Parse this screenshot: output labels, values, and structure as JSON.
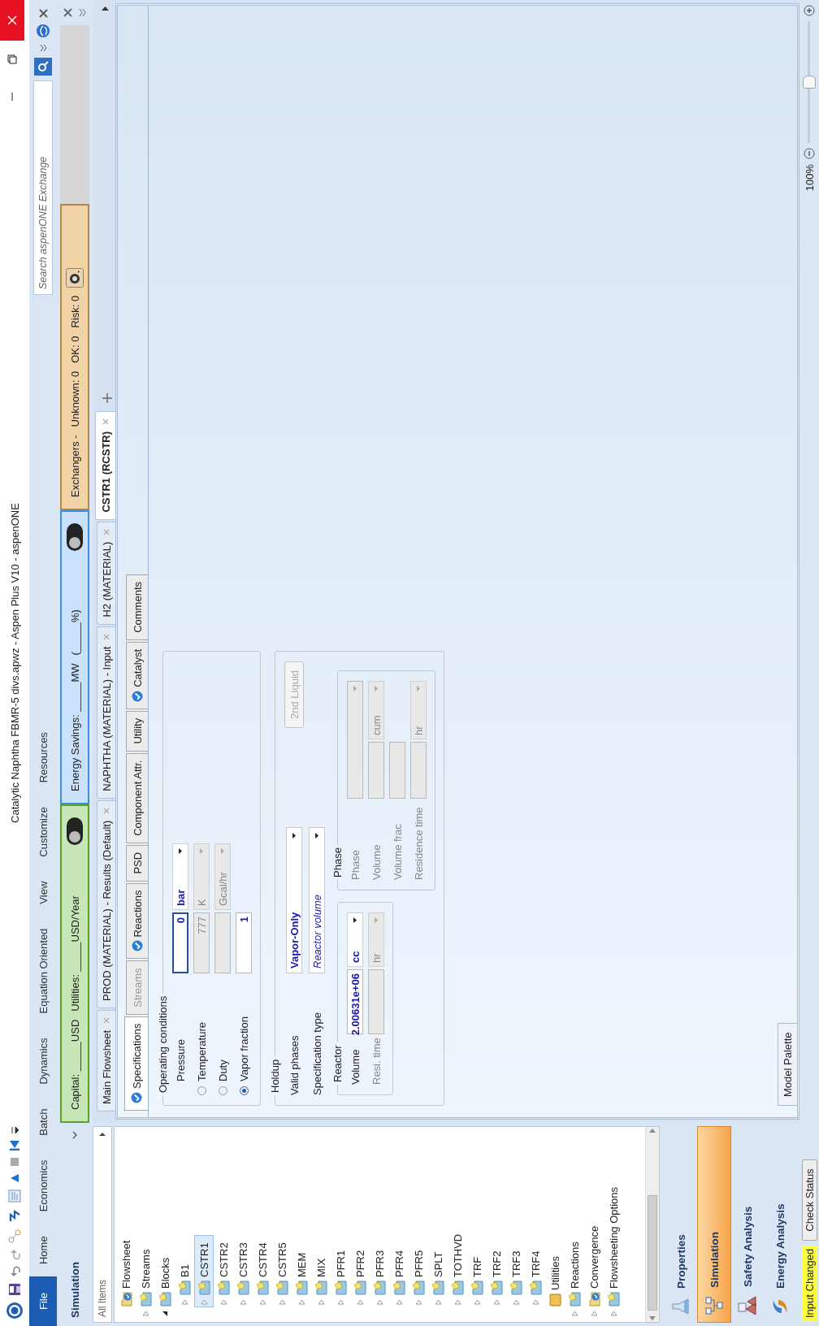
{
  "window": {
    "title": "Catalytic Naphtha FBMR-5 divs.apwz - Aspen Plus V10 - aspenONE"
  },
  "ribbon": {
    "tabs": [
      {
        "label": "File",
        "kind": "file",
        "selected": false
      },
      {
        "label": "Home",
        "kind": "tab",
        "selected": false
      },
      {
        "label": "Economics",
        "kind": "tab",
        "selected": false
      },
      {
        "label": "Batch",
        "kind": "tab",
        "selected": false
      },
      {
        "label": "Dynamics",
        "kind": "tab",
        "selected": false
      },
      {
        "label": "Equation Oriented",
        "kind": "tab",
        "selected": false
      },
      {
        "label": "View",
        "kind": "tab",
        "selected": false
      },
      {
        "label": "Customize",
        "kind": "tab",
        "selected": false
      },
      {
        "label": "Resources",
        "kind": "tab",
        "selected": false
      }
    ],
    "search": {
      "placeholder": "Search aspenONE Exchange"
    }
  },
  "economics": {
    "capital": "Capital: _____USD",
    "utilities": "Utilities: _____USD/Year",
    "toggle_on": false
  },
  "energy": {
    "savings": "Energy Savings: _____MW",
    "percent": "(_____%)",
    "toggle_on": false
  },
  "exchangers": {
    "label": "Exchangers -",
    "unknown": "Unknown: 0",
    "ok": "OK: 0",
    "risk": "Risk: 0"
  },
  "navigator": {
    "title": "Simulation",
    "filter": "All Items",
    "tree": [
      {
        "label": "Flowsheet",
        "kind": "check-folder",
        "selected": false
      },
      {
        "label": "Streams",
        "kind": "folder",
        "expanded": false,
        "selected": false
      },
      {
        "label": "Blocks",
        "kind": "folder",
        "expanded": true,
        "selected": false,
        "children": [
          {
            "label": "B1",
            "kind": "folder",
            "expanded": false,
            "selected": false
          },
          {
            "label": "CSTR1",
            "kind": "folder",
            "expanded": false,
            "selected": true
          },
          {
            "label": "CSTR2",
            "kind": "folder",
            "expanded": false,
            "selected": false
          },
          {
            "label": "CSTR3",
            "kind": "folder",
            "expanded": false,
            "selected": false
          },
          {
            "label": "CSTR4",
            "kind": "folder",
            "expanded": false,
            "selected": false
          },
          {
            "label": "CSTR5",
            "kind": "folder",
            "expanded": false,
            "selected": false
          },
          {
            "label": "MEM",
            "kind": "folder",
            "expanded": false,
            "selected": false
          },
          {
            "label": "MIX",
            "kind": "folder",
            "expanded": false,
            "selected": false
          },
          {
            "label": "PFR1",
            "kind": "folder",
            "expanded": false,
            "selected": false
          },
          {
            "label": "PFR2",
            "kind": "folder",
            "expanded": false,
            "selected": false
          },
          {
            "label": "PFR3",
            "kind": "folder",
            "expanded": false,
            "selected": false
          },
          {
            "label": "PFR4",
            "kind": "folder",
            "expanded": false,
            "selected": false
          },
          {
            "label": "PFR5",
            "kind": "folder",
            "expanded": false,
            "selected": false
          },
          {
            "label": "SPLT",
            "kind": "folder",
            "expanded": false,
            "selected": false
          },
          {
            "label": "TOTHVD",
            "kind": "folder",
            "expanded": false,
            "selected": false
          },
          {
            "label": "TRF",
            "kind": "folder",
            "expanded": false,
            "selected": false
          },
          {
            "label": "TRF2",
            "kind": "folder",
            "expanded": false,
            "selected": false
          },
          {
            "label": "TRF3",
            "kind": "folder",
            "expanded": false,
            "selected": false
          },
          {
            "label": "TRF4",
            "kind": "folder",
            "expanded": false,
            "selected": false
          }
        ]
      },
      {
        "label": "Utilities",
        "kind": "plain-folder",
        "selected": false
      },
      {
        "label": "Reactions",
        "kind": "folder",
        "expanded": false,
        "selected": false
      },
      {
        "label": "Convergence",
        "kind": "check-folder",
        "expanded": false,
        "selected": false
      },
      {
        "label": "Flowsheeting Options",
        "kind": "folder",
        "expanded": false,
        "selected": false
      }
    ],
    "buttons": [
      {
        "label": "Properties",
        "kind": "properties",
        "selected": false
      },
      {
        "label": "Simulation",
        "kind": "simulation",
        "selected": true
      },
      {
        "label": "Safety Analysis",
        "kind": "safety",
        "selected": false
      },
      {
        "label": "Energy Analysis",
        "kind": "energy",
        "selected": false
      }
    ]
  },
  "document_tabs": [
    {
      "label": "Main Flowsheet",
      "selected": false
    },
    {
      "label": "PROD (MATERIAL) - Results (Default)",
      "selected": false
    },
    {
      "label": "NAPHTHA (MATERIAL) - Input",
      "selected": false
    },
    {
      "label": "H2 (MATERIAL)",
      "selected": false
    },
    {
      "label": "CSTR1 (RCSTR)",
      "selected": true
    }
  ],
  "form_tabs": [
    {
      "label": "Specifications",
      "complete": true,
      "disabled": false,
      "selected": true
    },
    {
      "label": "Streams",
      "complete": false,
      "disabled": true,
      "selected": false
    },
    {
      "label": "Reactions",
      "complete": true,
      "disabled": false,
      "selected": false
    },
    {
      "label": "PSD",
      "complete": false,
      "disabled": false,
      "selected": false
    },
    {
      "label": "Component Attr.",
      "complete": false,
      "disabled": false,
      "selected": false
    },
    {
      "label": "Utility",
      "complete": false,
      "disabled": false,
      "selected": false
    },
    {
      "label": "Catalyst",
      "complete": true,
      "disabled": false,
      "selected": false
    },
    {
      "label": "Comments",
      "complete": false,
      "disabled": false,
      "selected": false
    }
  ],
  "operating_conditions": {
    "title": "Operating conditions",
    "rows": [
      {
        "label": "Pressure",
        "kind": "plain",
        "value": "0",
        "unit": "bar",
        "disabled": false
      },
      {
        "label": "Temperature",
        "kind": "radio",
        "selected": false,
        "value": "777",
        "unit": "K",
        "disabled": true
      },
      {
        "label": "Duty",
        "kind": "radio",
        "selected": false,
        "unit": "Gcal/hr",
        "disabled": true
      },
      {
        "label": "Vapor fraction",
        "kind": "radio",
        "selected": true,
        "value": "1",
        "disabled": false
      }
    ]
  },
  "holdup": {
    "title": "Holdup",
    "valid_phases": {
      "label": "Valid phases",
      "value": "Vapor-Only"
    },
    "spec_type": {
      "label": "Specification type",
      "value": "Reactor volume"
    },
    "button": {
      "label": "2nd Liquid",
      "disabled": true
    },
    "reactor": {
      "title": "Reactor",
      "rows": [
        {
          "label": "Volume",
          "value": "2.00631e+06",
          "unit": "cc",
          "disabled": false
        },
        {
          "label": "Resi. time",
          "unit": "hr",
          "disabled": true
        }
      ]
    },
    "phase": {
      "title": "Phase",
      "rows": [
        {
          "label": "Phase",
          "kind": "select",
          "disabled": true
        },
        {
          "label": "Volume",
          "kind": "value",
          "unit": "cum",
          "disabled": true
        },
        {
          "label": "Volume frac",
          "kind": "value",
          "disabled": true
        },
        {
          "label": "Residence time",
          "kind": "value",
          "unit": "hr",
          "disabled": true
        }
      ]
    }
  },
  "model_palette": "Model Palette",
  "status_bar": {
    "message": "Input Changed",
    "check_button": "Check Status",
    "zoom": "100%",
    "level": 0.5
  }
}
